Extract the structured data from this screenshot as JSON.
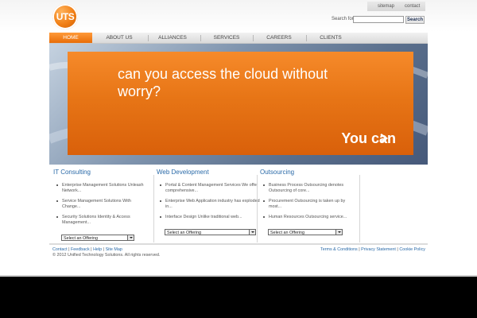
{
  "logo": {
    "text": "UTS"
  },
  "utility": {
    "sitemap": "sitemap",
    "contact": "contact"
  },
  "search": {
    "label": "Search for",
    "placeholder": "",
    "button": "Search"
  },
  "nav": {
    "items": [
      {
        "label": "HOME",
        "active": true
      },
      {
        "label": "ABOUT US",
        "active": false
      },
      {
        "label": "ALLIANCES",
        "active": false
      },
      {
        "label": "SERVICES",
        "active": false
      },
      {
        "label": "CAREERS",
        "active": false
      },
      {
        "label": "CLIENTS",
        "active": false
      }
    ]
  },
  "banner": {
    "headline": "can you access the cloud without worry?",
    "cta": "You can"
  },
  "columns": [
    {
      "title": "IT Consulting",
      "items": [
        "Enterprise Management Solutions Unleash Network...",
        "Service Management Solutions With Change...",
        "Security Solutions Identity & Access Management..."
      ],
      "select": "Select an Offering"
    },
    {
      "title": "Web Development",
      "items": [
        "Portal & Content Management Services We offer comprehensive...",
        "Enterprise Web Application industry has exploded in...",
        "Interface Design Unlike traditional web..."
      ],
      "select": "Select an Offering"
    },
    {
      "title": "Outsourcing",
      "items": [
        "Business Process Outsourcing denotes Outsourcing of core...",
        "Procurement Outsourcing is taken up by most...",
        "Human Resources Outsourcing service..."
      ],
      "select": "Select an Offering"
    }
  ],
  "footer": {
    "left_links": [
      "Contact",
      "Feedback",
      "Help",
      "Site Map"
    ],
    "copyright": "© 2012 Unified Technology Solutions. All rights reserved.",
    "right_links": [
      "Terms & Conditions",
      "Privacy Statement",
      "Cookie Policy"
    ]
  },
  "colors": {
    "accent": "#f07c12",
    "link": "#2a6aa8"
  }
}
